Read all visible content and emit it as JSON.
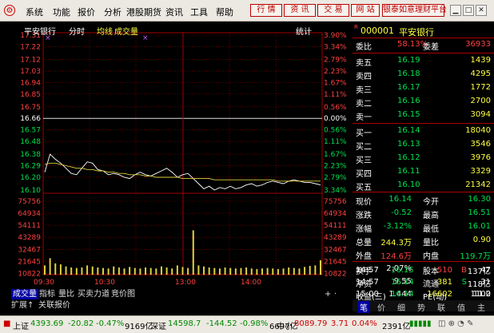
{
  "menu": [
    "系统",
    "功能",
    "报价",
    "分析",
    "港股期货",
    "资讯",
    "工具",
    "帮助"
  ],
  "toolbar": [
    "行 情",
    "资 讯",
    "交 易",
    "网 站"
  ],
  "ad_button": "银泰如意理财平台",
  "chart": {
    "stock_name": "平安银行",
    "period": "分时",
    "avg_label": "均线",
    "vol_label": "成交量",
    "stat_label": "统计",
    "price_ticks": [
      "17.31",
      "17.22",
      "17.12",
      "17.03",
      "16.94",
      "16.85",
      "16.75",
      "16.66",
      "16.57",
      "16.48",
      "16.38",
      "16.29",
      "16.20"
    ],
    "pct_ticks": [
      "3.90%",
      "3.34%",
      "2.79%",
      "2.23%",
      "1.67%",
      "1.11%",
      "0.56%",
      "0.00%",
      "0.56%",
      "1.11%",
      "1.67%",
      "2.23%",
      "2.79%"
    ],
    "pct_tick_color": [
      "red",
      "red",
      "red",
      "red",
      "red",
      "red",
      "red",
      "white",
      "green",
      "green",
      "green",
      "green",
      "green"
    ],
    "low_price": "16.10",
    "low_pct": "3.34%",
    "vol_ticks": [
      "75756",
      "64934",
      "54111",
      "43289",
      "32467",
      "21645",
      "10822"
    ],
    "time_ticks": [
      "09:30",
      "10:30",
      "13:00",
      "14:00"
    ],
    "price_series": [
      16.24,
      16.38,
      16.34,
      16.31,
      16.27,
      16.23,
      16.22,
      16.27,
      16.32,
      16.31,
      16.26,
      16.25,
      16.22,
      16.23,
      16.22,
      16.2,
      16.19,
      16.22,
      16.24,
      16.22,
      16.21,
      16.23,
      16.25,
      16.27,
      16.24,
      16.2,
      16.22,
      16.23,
      16.19,
      16.15,
      16.11,
      16.13,
      16.1,
      16.12,
      16.11,
      16.13,
      16.11,
      16.12,
      16.14,
      16.15,
      16.13,
      16.14,
      16.16,
      16.17,
      16.16,
      16.15,
      16.17,
      16.18,
      16.17,
      16.16,
      16.16,
      16.15,
      16.14
    ],
    "avg_series": [
      16.3,
      16.31,
      16.31,
      16.3,
      16.29,
      16.28,
      16.27,
      16.27,
      16.26,
      16.26,
      16.25,
      16.25,
      16.24,
      16.24,
      16.23,
      16.23,
      16.22,
      16.22,
      16.22,
      16.21,
      16.21,
      16.2,
      16.2,
      16.2,
      16.2,
      16.2,
      16.19,
      16.19,
      16.19,
      16.19,
      16.19,
      16.19,
      16.18,
      16.18,
      16.18,
      16.18,
      16.18,
      16.18,
      16.18,
      16.18,
      16.18,
      16.18,
      16.18,
      16.18,
      16.17,
      16.17,
      16.17,
      16.17,
      16.17,
      16.17,
      16.17,
      16.17,
      16.17
    ],
    "volume_series": [
      9000,
      16000,
      11000,
      10000,
      8000,
      7000,
      6500,
      7000,
      9000,
      8000,
      7000,
      6500,
      6000,
      8000,
      7000,
      6000,
      7500,
      6500,
      6000,
      7000,
      6500,
      6000,
      8000,
      7000,
      6000,
      9000,
      7500,
      6500,
      14000,
      9000,
      8000,
      7000,
      6500,
      6000,
      7000,
      6500,
      6000,
      6500,
      7000,
      6000,
      5500,
      6000,
      6500,
      6000,
      5500,
      6000,
      7000,
      6500,
      6000,
      7500,
      8500,
      9000,
      14000
    ],
    "volume_spike": {
      "index": 28,
      "value": 43000
    }
  },
  "tabs_bottom": [
    "成交量",
    "指标",
    "量比",
    "买卖力道",
    "竞价图"
  ],
  "tabs_bottom2": [
    "扩展↑",
    "关联报价"
  ],
  "quote": {
    "code": "000001",
    "name": "平安银行",
    "market_prefix": "R",
    "weibi_label": "委比",
    "weibi": "58.13%",
    "weicha_label": "委差",
    "weicha": "36933",
    "asks": [
      {
        "label": "卖五",
        "price": "16.19",
        "vol": "1439"
      },
      {
        "label": "卖四",
        "price": "16.18",
        "vol": "4295"
      },
      {
        "label": "卖三",
        "price": "16.17",
        "vol": "1772"
      },
      {
        "label": "卖二",
        "price": "16.16",
        "vol": "2700"
      },
      {
        "label": "卖一",
        "price": "16.15",
        "vol": "3094"
      }
    ],
    "bids": [
      {
        "label": "买一",
        "price": "16.14",
        "vol": "18040"
      },
      {
        "label": "买二",
        "price": "16.13",
        "vol": "3546"
      },
      {
        "label": "买三",
        "price": "16.12",
        "vol": "3976"
      },
      {
        "label": "买四",
        "price": "16.11",
        "vol": "3329"
      },
      {
        "label": "买五",
        "price": "16.10",
        "vol": "21342"
      }
    ],
    "stats": [
      {
        "l1": "现价",
        "v1": "16.14",
        "c1": "green",
        "l2": "今开",
        "v2": "16.30",
        "c2": "green"
      },
      {
        "l1": "涨跌",
        "v1": "-0.52",
        "c1": "green",
        "l2": "最高",
        "v2": "16.51",
        "c2": "green"
      },
      {
        "l1": "涨幅",
        "v1": "-3.12%",
        "c1": "green",
        "l2": "最低",
        "v2": "16.01",
        "c2": "green"
      },
      {
        "l1": "总量",
        "v1": "244.3万",
        "c1": "yellow",
        "l2": "量比",
        "v2": "0.90",
        "c2": "yellow"
      },
      {
        "l1": "外盘",
        "v1": "124.6万",
        "c1": "red",
        "l2": "内盘",
        "v2": "119.7万",
        "c2": "green"
      }
    ],
    "fund": [
      {
        "l1": "换手",
        "v1": "2.07%",
        "l2": "股本",
        "v2": "137亿"
      },
      {
        "l1": "净资",
        "v1": "9.55",
        "l2": "流通",
        "v2": "118亿"
      },
      {
        "l1": "收益(三)",
        "v1": "1.444",
        "l2": "PE(动)",
        "v2": "11.2"
      }
    ],
    "ticks": [
      {
        "time": "14:57",
        "price": "16.15",
        "vol": "510",
        "flag": "B",
        "num": "47"
      },
      {
        "time": "14:57",
        "price": "16.14",
        "vol": "381",
        "flag": "S",
        "num": "31"
      },
      {
        "time": "15:00",
        "price": "16.14",
        "vol": "16602",
        "flag": "",
        "num": "1100"
      }
    ],
    "bottom_tabs": [
      "笔",
      "价",
      "细",
      "势",
      "联",
      "值",
      "主"
    ]
  },
  "status": {
    "sh_label": "上证",
    "sh_value": "4393.69",
    "sh_chg": "-20.82",
    "sh_pct": "-0.47%",
    "sh_amt": "9169亿",
    "sz_label": "深证",
    "sz_value": "14598.7",
    "sz_chg": "-144.52",
    "sz_pct": "-0.98%",
    "sz_amt": "6697亿",
    "zx_label": "中小",
    "zx_value": "8089.79",
    "zx_chg": "3.71",
    "zx_pct": "0.04%",
    "zx_amt": "2391亿"
  },
  "colors": {
    "up": "#ff4040",
    "down": "#00e050",
    "grid": "#a00000",
    "avg": "#e0d040"
  }
}
